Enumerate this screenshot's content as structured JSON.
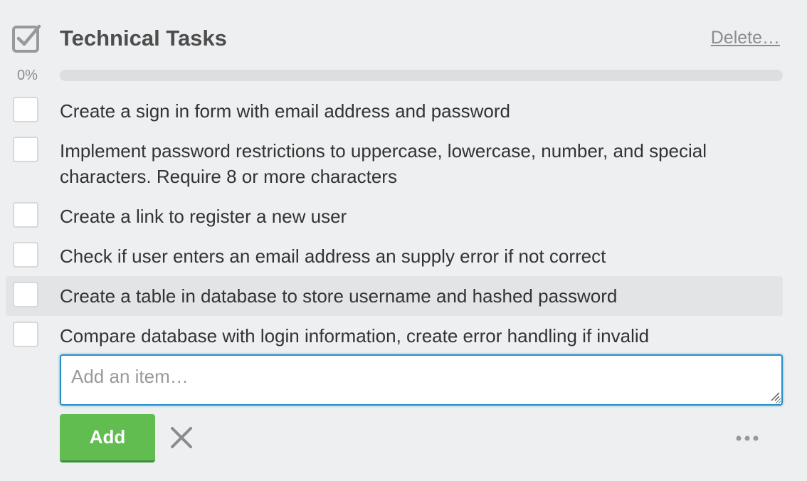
{
  "checklist": {
    "title": "Technical Tasks",
    "delete_label": "Delete…",
    "icon": "checklist-icon",
    "progress": {
      "label": "0%",
      "percent": 0,
      "fill_color": "#5aac44"
    },
    "items": [
      {
        "text": "Create a sign in form with email address and password",
        "checked": false
      },
      {
        "text": "Implement password restrictions to uppercase, lowercase, number, and special characters. Require 8 or more characters",
        "checked": false
      },
      {
        "text": "Create a link to register a new user",
        "checked": false
      },
      {
        "text": "Check if user enters an email address an supply error if not correct",
        "checked": false
      },
      {
        "text": "Create a table in database to store username and hashed password",
        "checked": false,
        "hovered": true
      },
      {
        "text": "Compare database with login information, create error handling if invalid",
        "checked": false
      }
    ],
    "add_item": {
      "placeholder": "Add an item…",
      "value": ""
    },
    "add_button_label": "Add",
    "cancel_icon": "close-icon",
    "more_icon": "more-options-icon"
  },
  "colors": {
    "background": "#edeff0",
    "accent_green": "#61bd4f",
    "focus_blue": "#298fca"
  }
}
